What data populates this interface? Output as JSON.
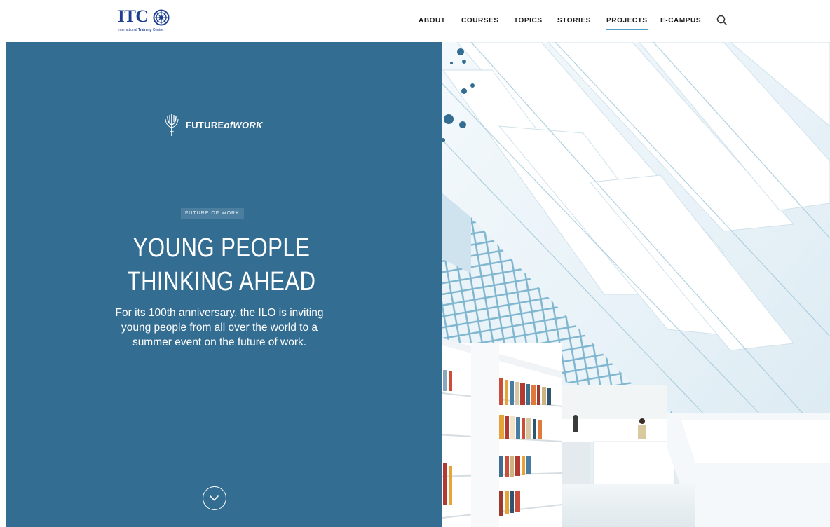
{
  "header": {
    "logo": {
      "main_text": "ITC",
      "sub_text_regular": "International ",
      "sub_text_bold": "Training",
      "sub_text_end": " Centre",
      "icon": "ilo-emblem-icon",
      "brand_color": "#1f3f8f"
    },
    "nav": {
      "items": [
        {
          "label": "ABOUT",
          "active": false
        },
        {
          "label": "COURSES",
          "active": false
        },
        {
          "label": "TOPICS",
          "active": false
        },
        {
          "label": "STORIES",
          "active": false
        },
        {
          "label": "PROJECTS",
          "active": true
        },
        {
          "label": "E-CAMPUS",
          "active": false
        }
      ],
      "search_icon": "search-icon",
      "active_underline_color": "#4b9cc9"
    }
  },
  "hero": {
    "panel_color": "#336d92",
    "brand_logo": {
      "icon": "ilo-torch-icon",
      "text_future": "FUTURE",
      "text_of": "of",
      "text_work": "WORK"
    },
    "tag": "FUTURE OF WORK",
    "title_line1": "YOUNG PEOPLE",
    "title_line2": "THINKING AHEAD",
    "description": "For its 100th anniversary, the ILO is inviting young people from all over the world to a summer event on the future of work.",
    "scroll_icon": "chevron-down-circle-icon",
    "image": {
      "subject": "library-interior-image"
    }
  }
}
